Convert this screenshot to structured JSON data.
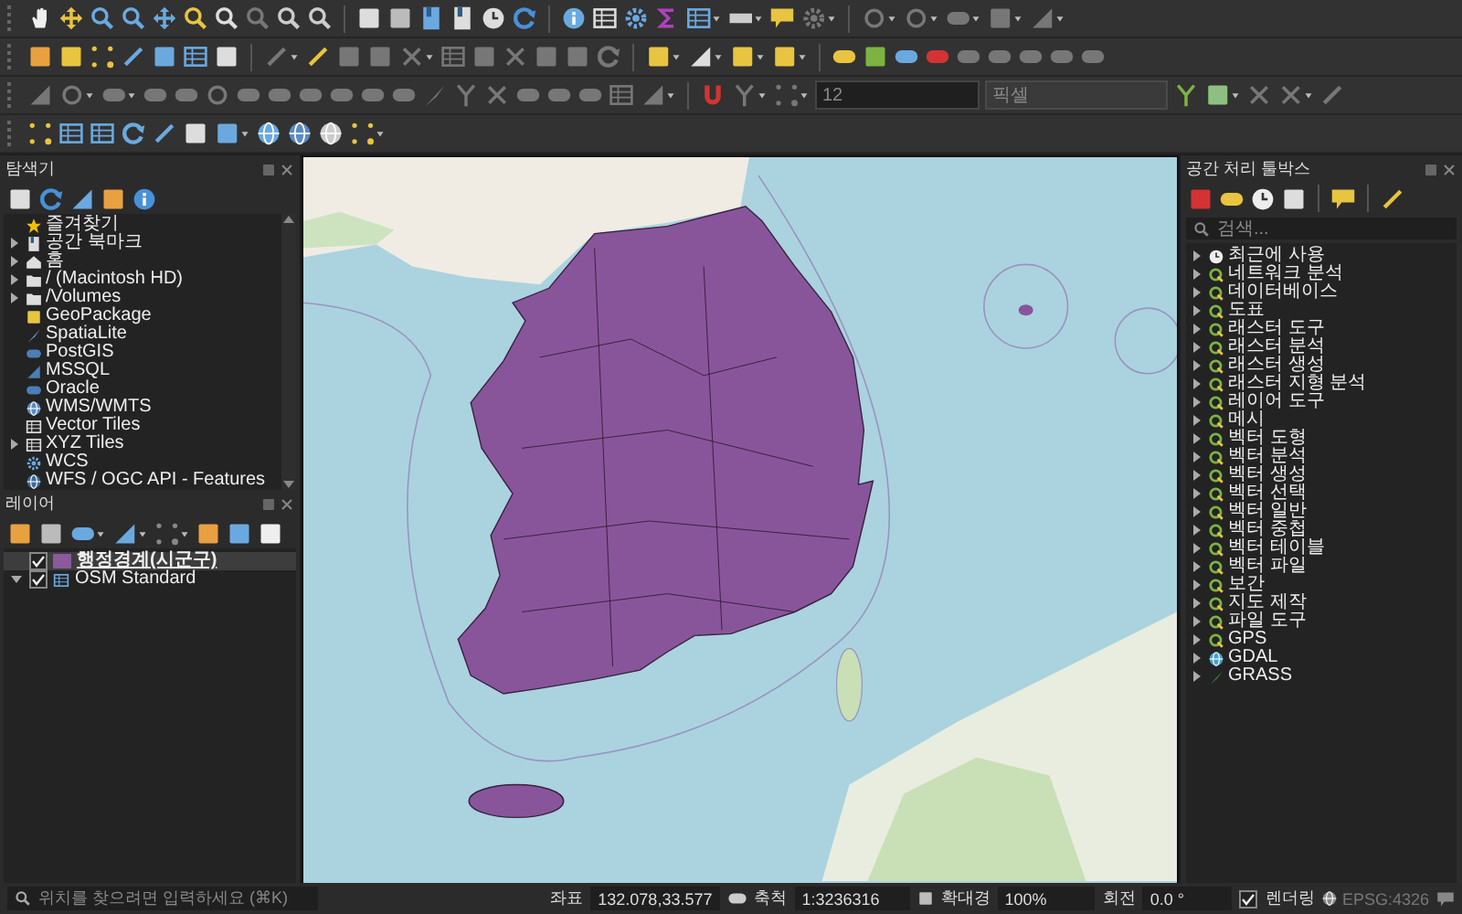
{
  "toolbars": {
    "snapping_tolerance": "12",
    "snapping_unit": "픽셀"
  },
  "browser_panel": {
    "title": "탐색기",
    "items": [
      {
        "label": "즐겨찾기",
        "kind": "star",
        "expandable": false
      },
      {
        "label": "공간 북마크",
        "kind": "bookmark",
        "expandable": true
      },
      {
        "label": "홈",
        "kind": "home",
        "expandable": true
      },
      {
        "label": "/ (Macintosh HD)",
        "kind": "folder",
        "expandable": true
      },
      {
        "label": "/Volumes",
        "kind": "folder",
        "expandable": true
      },
      {
        "label": "GeoPackage",
        "kind": "geopackage",
        "expandable": false
      },
      {
        "label": "SpatiaLite",
        "kind": "spatialite",
        "expandable": false
      },
      {
        "label": "PostGIS",
        "kind": "postgis",
        "expandable": false
      },
      {
        "label": "MSSQL",
        "kind": "mssql",
        "expandable": false
      },
      {
        "label": "Oracle",
        "kind": "oracle",
        "expandable": false
      },
      {
        "label": "WMS/WMTS",
        "kind": "wms",
        "expandable": false
      },
      {
        "label": "Vector Tiles",
        "kind": "tiles",
        "expandable": false
      },
      {
        "label": "XYZ Tiles",
        "kind": "tiles",
        "expandable": true
      },
      {
        "label": "WCS",
        "kind": "wcs",
        "expandable": false
      },
      {
        "label": "WFS / OGC API - Features",
        "kind": "wfs",
        "expandable": false
      }
    ]
  },
  "layers_panel": {
    "title": "레이어",
    "layers": [
      {
        "name": "행정경계(시군구)",
        "kind": "polygon",
        "checked": true,
        "selected": true,
        "expanded": false
      },
      {
        "name": "OSM Standard",
        "kind": "raster",
        "checked": true,
        "selected": false,
        "expanded": true
      }
    ]
  },
  "toolbox_panel": {
    "title": "공간 처리 툴박스",
    "search_placeholder": "검색...",
    "providers": [
      {
        "label": "최근에 사용",
        "kind": "recent",
        "expandable": true
      },
      {
        "label": "네트워크 분석",
        "kind": "qgis",
        "expandable": true
      },
      {
        "label": "데이터베이스",
        "kind": "qgis",
        "expandable": true
      },
      {
        "label": "도표",
        "kind": "qgis",
        "expandable": true
      },
      {
        "label": "래스터 도구",
        "kind": "qgis",
        "expandable": true
      },
      {
        "label": "래스터 분석",
        "kind": "qgis",
        "expandable": true
      },
      {
        "label": "래스터 생성",
        "kind": "qgis",
        "expandable": true
      },
      {
        "label": "래스터 지형 분석",
        "kind": "qgis",
        "expandable": true
      },
      {
        "label": "레이어 도구",
        "kind": "qgis",
        "expandable": true
      },
      {
        "label": "메시",
        "kind": "qgis",
        "expandable": true
      },
      {
        "label": "벡터 도형",
        "kind": "qgis",
        "expandable": true
      },
      {
        "label": "벡터 분석",
        "kind": "qgis",
        "expandable": true
      },
      {
        "label": "벡터 생성",
        "kind": "qgis",
        "expandable": true
      },
      {
        "label": "벡터 선택",
        "kind": "qgis",
        "expandable": true
      },
      {
        "label": "벡터 일반",
        "kind": "qgis",
        "expandable": true
      },
      {
        "label": "벡터 중첩",
        "kind": "qgis",
        "expandable": true
      },
      {
        "label": "벡터 테이블",
        "kind": "qgis",
        "expandable": true
      },
      {
        "label": "벡터 파일",
        "kind": "qgis",
        "expandable": true
      },
      {
        "label": "보간",
        "kind": "qgis",
        "expandable": true
      },
      {
        "label": "지도 제작",
        "kind": "qgis",
        "expandable": true
      },
      {
        "label": "파일 도구",
        "kind": "qgis",
        "expandable": true
      },
      {
        "label": "GPS",
        "kind": "qgis",
        "expandable": true
      },
      {
        "label": "GDAL",
        "kind": "gdal",
        "expandable": true
      },
      {
        "label": "GRASS",
        "kind": "grass",
        "expandable": true
      }
    ]
  },
  "status_bar": {
    "locator_placeholder": "위치를 찾으려면 입력하세요 (⌘K)",
    "coordinate_label": "좌표",
    "coordinate": "132.078,33.577",
    "scale_label": "축척",
    "scale": "1:3236316",
    "magnifier_label": "확대경",
    "magnifier": "100%",
    "rotation_label": "회전",
    "rotation": "0.0 °",
    "render_label": "렌더링",
    "render_checked": true,
    "crs": "EPSG:4326"
  }
}
